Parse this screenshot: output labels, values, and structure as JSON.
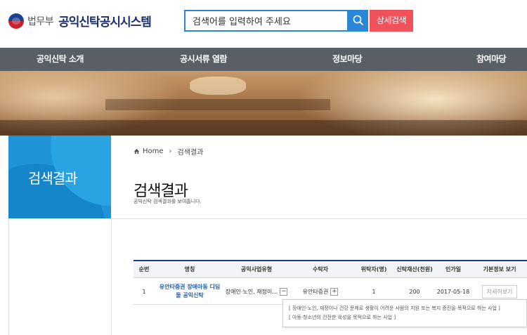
{
  "header": {
    "ministry": "법무부",
    "system_name": "공익신탁공시시스템",
    "search_value": "검색어를 입력하여 주세요",
    "advanced_search": "상세검색"
  },
  "nav": [
    "공익신탁 소개",
    "공시서류 열람",
    "정보마당",
    "참여마당"
  ],
  "side": {
    "title": "검색결과"
  },
  "breadcrumb": {
    "home": "Home",
    "current": "검색결과"
  },
  "page": {
    "title": "검색결과",
    "subtitle": "공익신탁 검색결과를 보여줍니다."
  },
  "table": {
    "headers": [
      "순번",
      "명칭",
      "공익사업유형",
      "수탁자",
      "위탁자(명)",
      "신탁재산(천원)",
      "인가일",
      "기본정보 보기"
    ],
    "rows": [
      {
        "no": "1",
        "name_line1": "유안타증권 장애아동 디딤",
        "name_line2": "돌 공익신탁",
        "type": "장애인·노인, 재정이…",
        "trustee": "유안타증권",
        "trustors": "1",
        "assets": "200",
        "date": "2017-05-18",
        "detail": "자세히보기"
      }
    ]
  },
  "tooltip": {
    "line1": "[ 장애인·노인, 재정이나 건강 문제로 생활이 어려운 사람의 지원 또는 복지 증진을 목적으로 하는 사업 ]",
    "line2": "[ 아동·청소년의 건전한 육성을 목적으로 하는 사업 ]"
  }
}
